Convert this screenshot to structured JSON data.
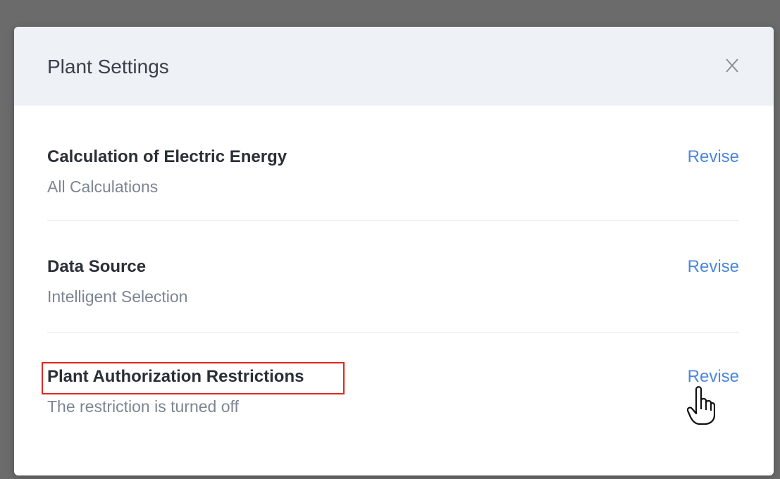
{
  "dialog": {
    "title": "Plant Settings",
    "close_label": "X"
  },
  "settings": [
    {
      "title": "Calculation of Electric Energy",
      "value": "All Calculations",
      "action": "Revise"
    },
    {
      "title": "Data Source",
      "value": "Intelligent Selection",
      "action": "Revise"
    },
    {
      "title": "Plant Authorization Restrictions",
      "value": "The restriction is turned off",
      "action": "Revise"
    }
  ],
  "colors": {
    "link": "#4a86e0",
    "highlight": "#e0281f",
    "header_bg": "#eef1f5"
  }
}
